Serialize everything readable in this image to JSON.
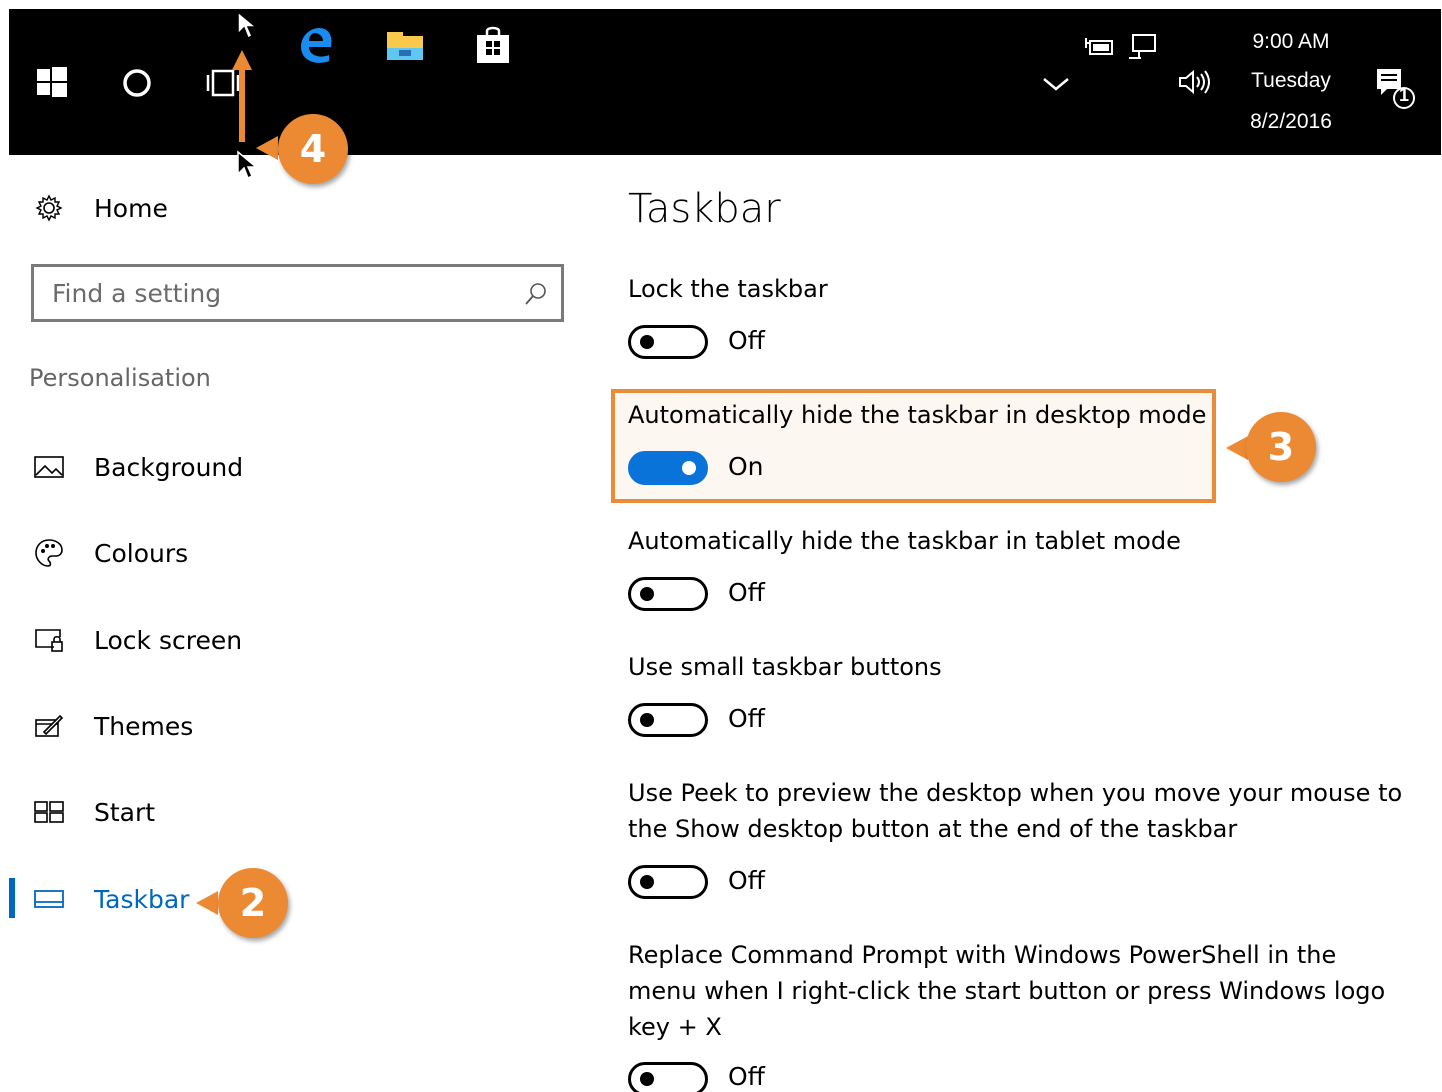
{
  "taskbar": {
    "time": "9:00 AM",
    "day": "Tuesday",
    "date": "8/2/2016",
    "notification_count": "1",
    "icons": [
      "windows-start-icon",
      "cortana-icon",
      "task-view-icon",
      "edge-icon",
      "file-explorer-icon",
      "store-icon",
      "chevron-up-icon",
      "power-icon",
      "network-icon",
      "volume-icon",
      "action-center-icon"
    ]
  },
  "sidebar": {
    "home_label": "Home",
    "search_placeholder": "Find a setting",
    "section_title": "Personalisation",
    "items": [
      {
        "label": "Background",
        "icon": "picture-icon"
      },
      {
        "label": "Colours",
        "icon": "palette-icon"
      },
      {
        "label": "Lock screen",
        "icon": "lock-screen-icon"
      },
      {
        "label": "Themes",
        "icon": "themes-icon"
      },
      {
        "label": "Start",
        "icon": "start-icon"
      },
      {
        "label": "Taskbar",
        "icon": "taskbar-icon",
        "selected": true
      }
    ]
  },
  "main": {
    "title": "Taskbar",
    "settings": [
      {
        "label": "Lock the taskbar",
        "state": "Off"
      },
      {
        "label": "Automatically hide the taskbar in desktop mode",
        "state": "On"
      },
      {
        "label": "Automatically hide the taskbar in tablet mode",
        "state": "Off"
      },
      {
        "label": "Use small taskbar buttons",
        "state": "Off"
      },
      {
        "label": "Use Peek to preview the desktop when you move your mouse to the Show desktop button at the end of the taskbar",
        "state": "Off"
      },
      {
        "label": "Replace Command Prompt with Windows PowerShell in the menu when I right-click the start button or press Windows logo key + X",
        "state": "Off"
      }
    ]
  },
  "callouts": {
    "step2": "2",
    "step3": "3",
    "step4": "4"
  },
  "colors": {
    "accent": "#0a73d9",
    "callout": "#ec8a34",
    "taskbar": "#000000"
  }
}
